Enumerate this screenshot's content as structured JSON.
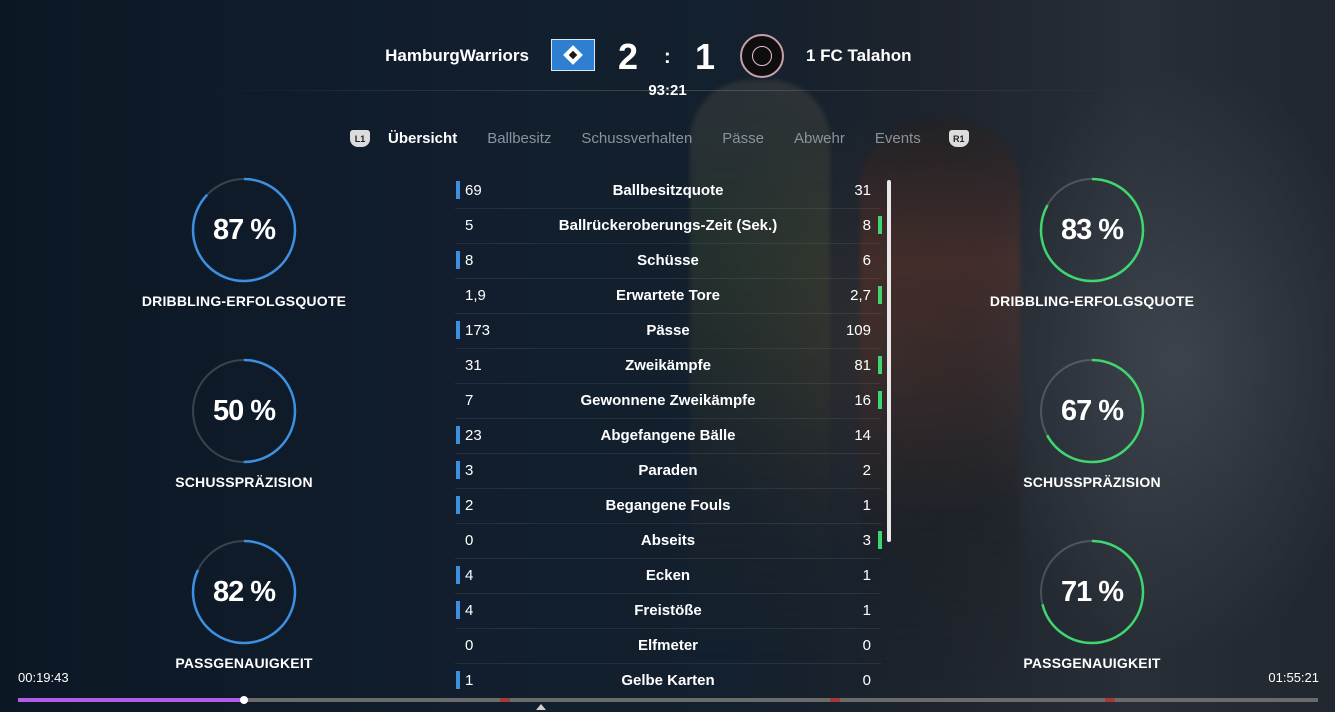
{
  "match": {
    "home_team": "HamburgWarriors",
    "away_team": "1 FC Talahon",
    "home_score": "2",
    "separator": ":",
    "away_score": "1",
    "clock": "93:21"
  },
  "tabs": {
    "left_button": "L1",
    "right_button": "R1",
    "items": [
      "Übersicht",
      "Ballbesitz",
      "Schussverhalten",
      "Pässe",
      "Abwehr",
      "Events"
    ],
    "active_index": 0
  },
  "home_rings": [
    {
      "value": "87 %",
      "fraction": 0.87,
      "label": "DRIBBLING-ERFOLGSQUOTE"
    },
    {
      "value": "50 %",
      "fraction": 0.5,
      "label": "SCHUSSPRÄZISION"
    },
    {
      "value": "82 %",
      "fraction": 0.82,
      "label": "PASSGENAUIGKEIT"
    }
  ],
  "away_rings": [
    {
      "value": "83 %",
      "fraction": 0.83,
      "label": "DRIBBLING-ERFOLGSQUOTE"
    },
    {
      "value": "67 %",
      "fraction": 0.67,
      "label": "SCHUSSPRÄZISION"
    },
    {
      "value": "71 %",
      "fraction": 0.71,
      "label": "PASSGENAUIGKEIT"
    }
  ],
  "colors": {
    "home_accent": "#3d8fe0",
    "away_accent": "#3fd66f",
    "progress": "#b55be8"
  },
  "stats": [
    {
      "home": "69",
      "name": "Ballbesitzquote",
      "away": "31",
      "leader": "home"
    },
    {
      "home": "5",
      "name": "Ballrückeroberungs-Zeit (Sek.)",
      "away": "8",
      "leader": "away"
    },
    {
      "home": "8",
      "name": "Schüsse",
      "away": "6",
      "leader": "home"
    },
    {
      "home": "1,9",
      "name": "Erwartete Tore",
      "away": "2,7",
      "leader": "away"
    },
    {
      "home": "173",
      "name": "Pässe",
      "away": "109",
      "leader": "home"
    },
    {
      "home": "31",
      "name": "Zweikämpfe",
      "away": "81",
      "leader": "away"
    },
    {
      "home": "7",
      "name": "Gewonnene Zweikämpfe",
      "away": "16",
      "leader": "away"
    },
    {
      "home": "23",
      "name": "Abgefangene Bälle",
      "away": "14",
      "leader": "home"
    },
    {
      "home": "3",
      "name": "Paraden",
      "away": "2",
      "leader": "home"
    },
    {
      "home": "2",
      "name": "Begangene Fouls",
      "away": "1",
      "leader": "home"
    },
    {
      "home": "0",
      "name": "Abseits",
      "away": "3",
      "leader": "away"
    },
    {
      "home": "4",
      "name": "Ecken",
      "away": "1",
      "leader": "home"
    },
    {
      "home": "4",
      "name": "Freistöße",
      "away": "1",
      "leader": "home"
    },
    {
      "home": "0",
      "name": "Elfmeter",
      "away": "0",
      "leader": "none"
    },
    {
      "home": "1",
      "name": "Gelbe Karten",
      "away": "0",
      "leader": "home"
    }
  ],
  "player": {
    "elapsed": "00:19:43",
    "total": "01:55:21",
    "progress_fraction": 0.174
  }
}
